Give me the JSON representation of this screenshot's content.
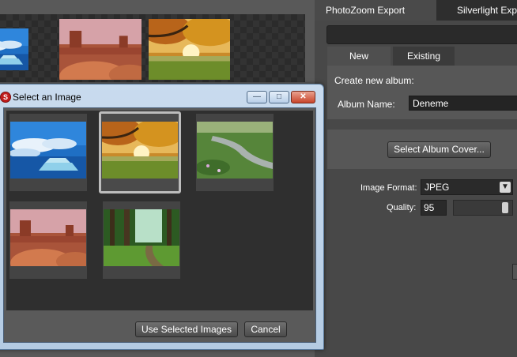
{
  "right_panel": {
    "tabs": [
      {
        "label": "PhotoZoom Export",
        "active": true
      },
      {
        "label": "Silverlight Expo",
        "active": false
      }
    ],
    "subtabs": [
      {
        "label": "New",
        "active": true
      },
      {
        "label": "Existing",
        "active": false
      }
    ],
    "create_label": "Create new album:",
    "album_name_label": "Album Name:",
    "album_name_value": "Deneme",
    "select_cover_label": "Select Album Cover...",
    "image_format_label": "Image Format:",
    "image_format_value": "JPEG",
    "quality_label": "Quality:",
    "quality_value": "95"
  },
  "dialog": {
    "title": "Select an Image",
    "icon": "app-logo-icon",
    "use_selected_label": "Use Selected Images",
    "cancel_label": "Cancel",
    "images": [
      {
        "name": "ocean-pier",
        "selected": false
      },
      {
        "name": "autumn-tree",
        "selected": true
      },
      {
        "name": "meadow-stream",
        "selected": false
      },
      {
        "name": "desert-mesa",
        "selected": false
      },
      {
        "name": "forest-path",
        "selected": false
      }
    ]
  },
  "colors": {
    "dialog_frame": "#c9dbee",
    "panel_bg": "#484848",
    "selection_border": "#bdbdbd"
  }
}
